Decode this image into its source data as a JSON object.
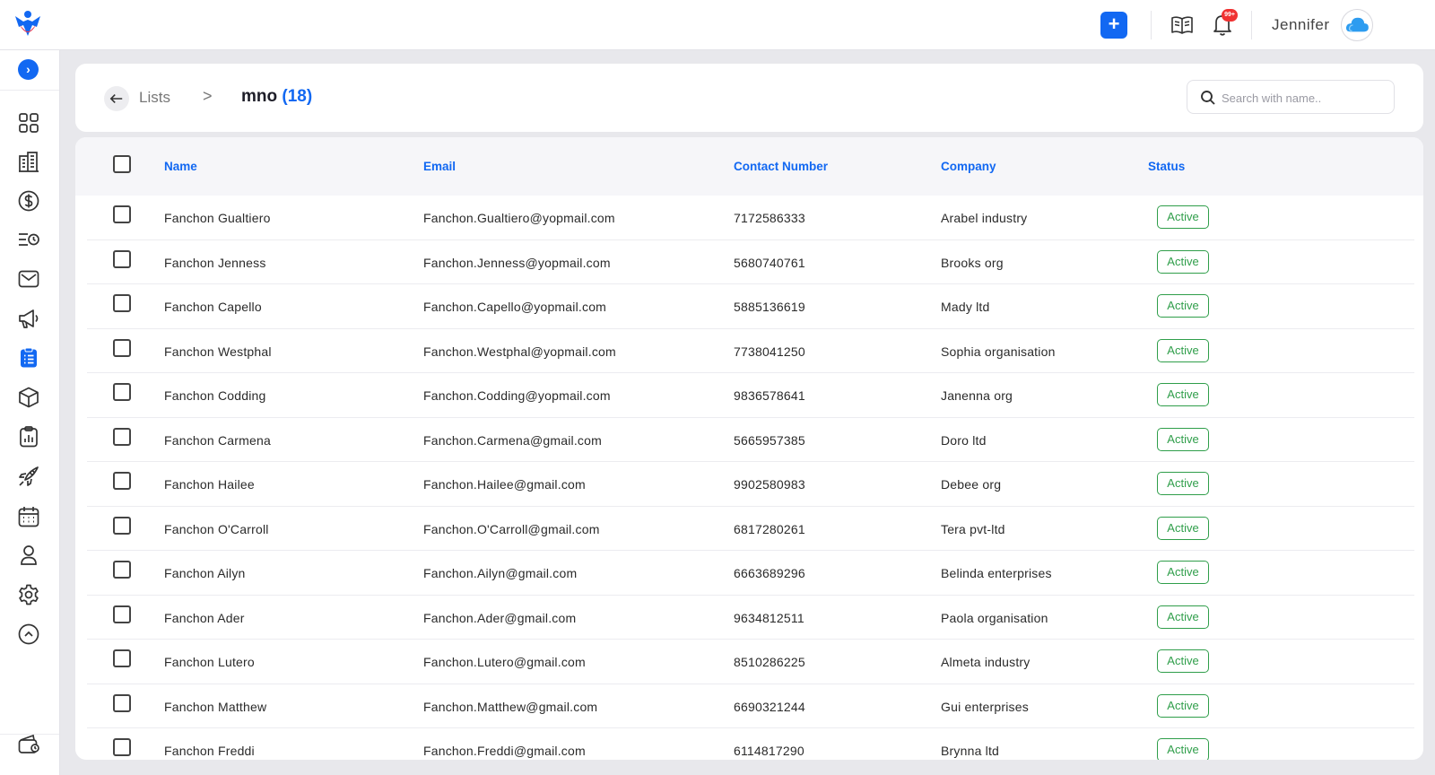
{
  "topbar": {
    "add_label": "+",
    "notification_badge": "99+",
    "user_name": "Jennifer",
    "logo_icon": "brand-logo-icon",
    "book_icon": "open-book-icon",
    "bell_icon": "bell-icon",
    "avatar_icon": "cloud-avatar-icon"
  },
  "sidebar": {
    "expand_label": "›",
    "items": [
      {
        "icon": "dashboard-grid-icon"
      },
      {
        "icon": "building-icon"
      },
      {
        "icon": "dollar-icon"
      },
      {
        "icon": "list-clock-icon"
      },
      {
        "icon": "mail-icon"
      },
      {
        "icon": "megaphone-icon"
      },
      {
        "icon": "clipboard-list-icon",
        "active": true
      },
      {
        "icon": "box-icon"
      },
      {
        "icon": "report-clipboard-icon"
      },
      {
        "icon": "rocket-icon"
      },
      {
        "icon": "calendar-icon"
      },
      {
        "icon": "user-icon"
      },
      {
        "icon": "settings-icon"
      },
      {
        "icon": "chevron-up-circle-icon"
      },
      {
        "icon": "wallet-icon"
      }
    ]
  },
  "breadcrumb": {
    "parent": "Lists",
    "separator": ">",
    "current": "mno",
    "count": "(18)"
  },
  "search": {
    "placeholder": "Search with name.."
  },
  "colors": {
    "accent": "#1268f2",
    "status_active": "#2f9e4a",
    "badge_red": "#f03232"
  },
  "table": {
    "columns": [
      "Name",
      "Email",
      "Contact Number",
      "Company",
      "Status"
    ],
    "rows": [
      {
        "name": "Fanchon Gualtiero",
        "email": "Fanchon.Gualtiero@yopmail.com",
        "phone": "7172586333",
        "company": "Arabel industry",
        "status": "Active"
      },
      {
        "name": "Fanchon Jenness",
        "email": "Fanchon.Jenness@yopmail.com",
        "phone": "5680740761",
        "company": "Brooks org",
        "status": "Active"
      },
      {
        "name": "Fanchon Capello",
        "email": "Fanchon.Capello@yopmail.com",
        "phone": "5885136619",
        "company": "Mady ltd",
        "status": "Active"
      },
      {
        "name": "Fanchon Westphal",
        "email": "Fanchon.Westphal@yopmail.com",
        "phone": "7738041250",
        "company": "Sophia organisation",
        "status": "Active"
      },
      {
        "name": "Fanchon Codding",
        "email": "Fanchon.Codding@yopmail.com",
        "phone": "9836578641",
        "company": "Janenna org",
        "status": "Active"
      },
      {
        "name": "Fanchon Carmena",
        "email": "Fanchon.Carmena@gmail.com",
        "phone": "5665957385",
        "company": "Doro ltd",
        "status": "Active"
      },
      {
        "name": "Fanchon Hailee",
        "email": "Fanchon.Hailee@gmail.com",
        "phone": "9902580983",
        "company": "Debee org",
        "status": "Active"
      },
      {
        "name": "Fanchon O'Carroll",
        "email": "Fanchon.O'Carroll@gmail.com",
        "phone": "6817280261",
        "company": "Tera pvt-ltd",
        "status": "Active"
      },
      {
        "name": "Fanchon Ailyn",
        "email": "Fanchon.Ailyn@gmail.com",
        "phone": "6663689296",
        "company": "Belinda enterprises",
        "status": "Active"
      },
      {
        "name": "Fanchon Ader",
        "email": "Fanchon.Ader@gmail.com",
        "phone": "9634812511",
        "company": "Paola organisation",
        "status": "Active"
      },
      {
        "name": "Fanchon Lutero",
        "email": "Fanchon.Lutero@gmail.com",
        "phone": "8510286225",
        "company": "Almeta industry",
        "status": "Active"
      },
      {
        "name": "Fanchon Matthew",
        "email": "Fanchon.Matthew@gmail.com",
        "phone": "6690321244",
        "company": "Gui enterprises",
        "status": "Active"
      },
      {
        "name": "Fanchon Freddi",
        "email": "Fanchon.Freddi@gmail.com",
        "phone": "6114817290",
        "company": "Brynna ltd",
        "status": "Active"
      }
    ]
  }
}
